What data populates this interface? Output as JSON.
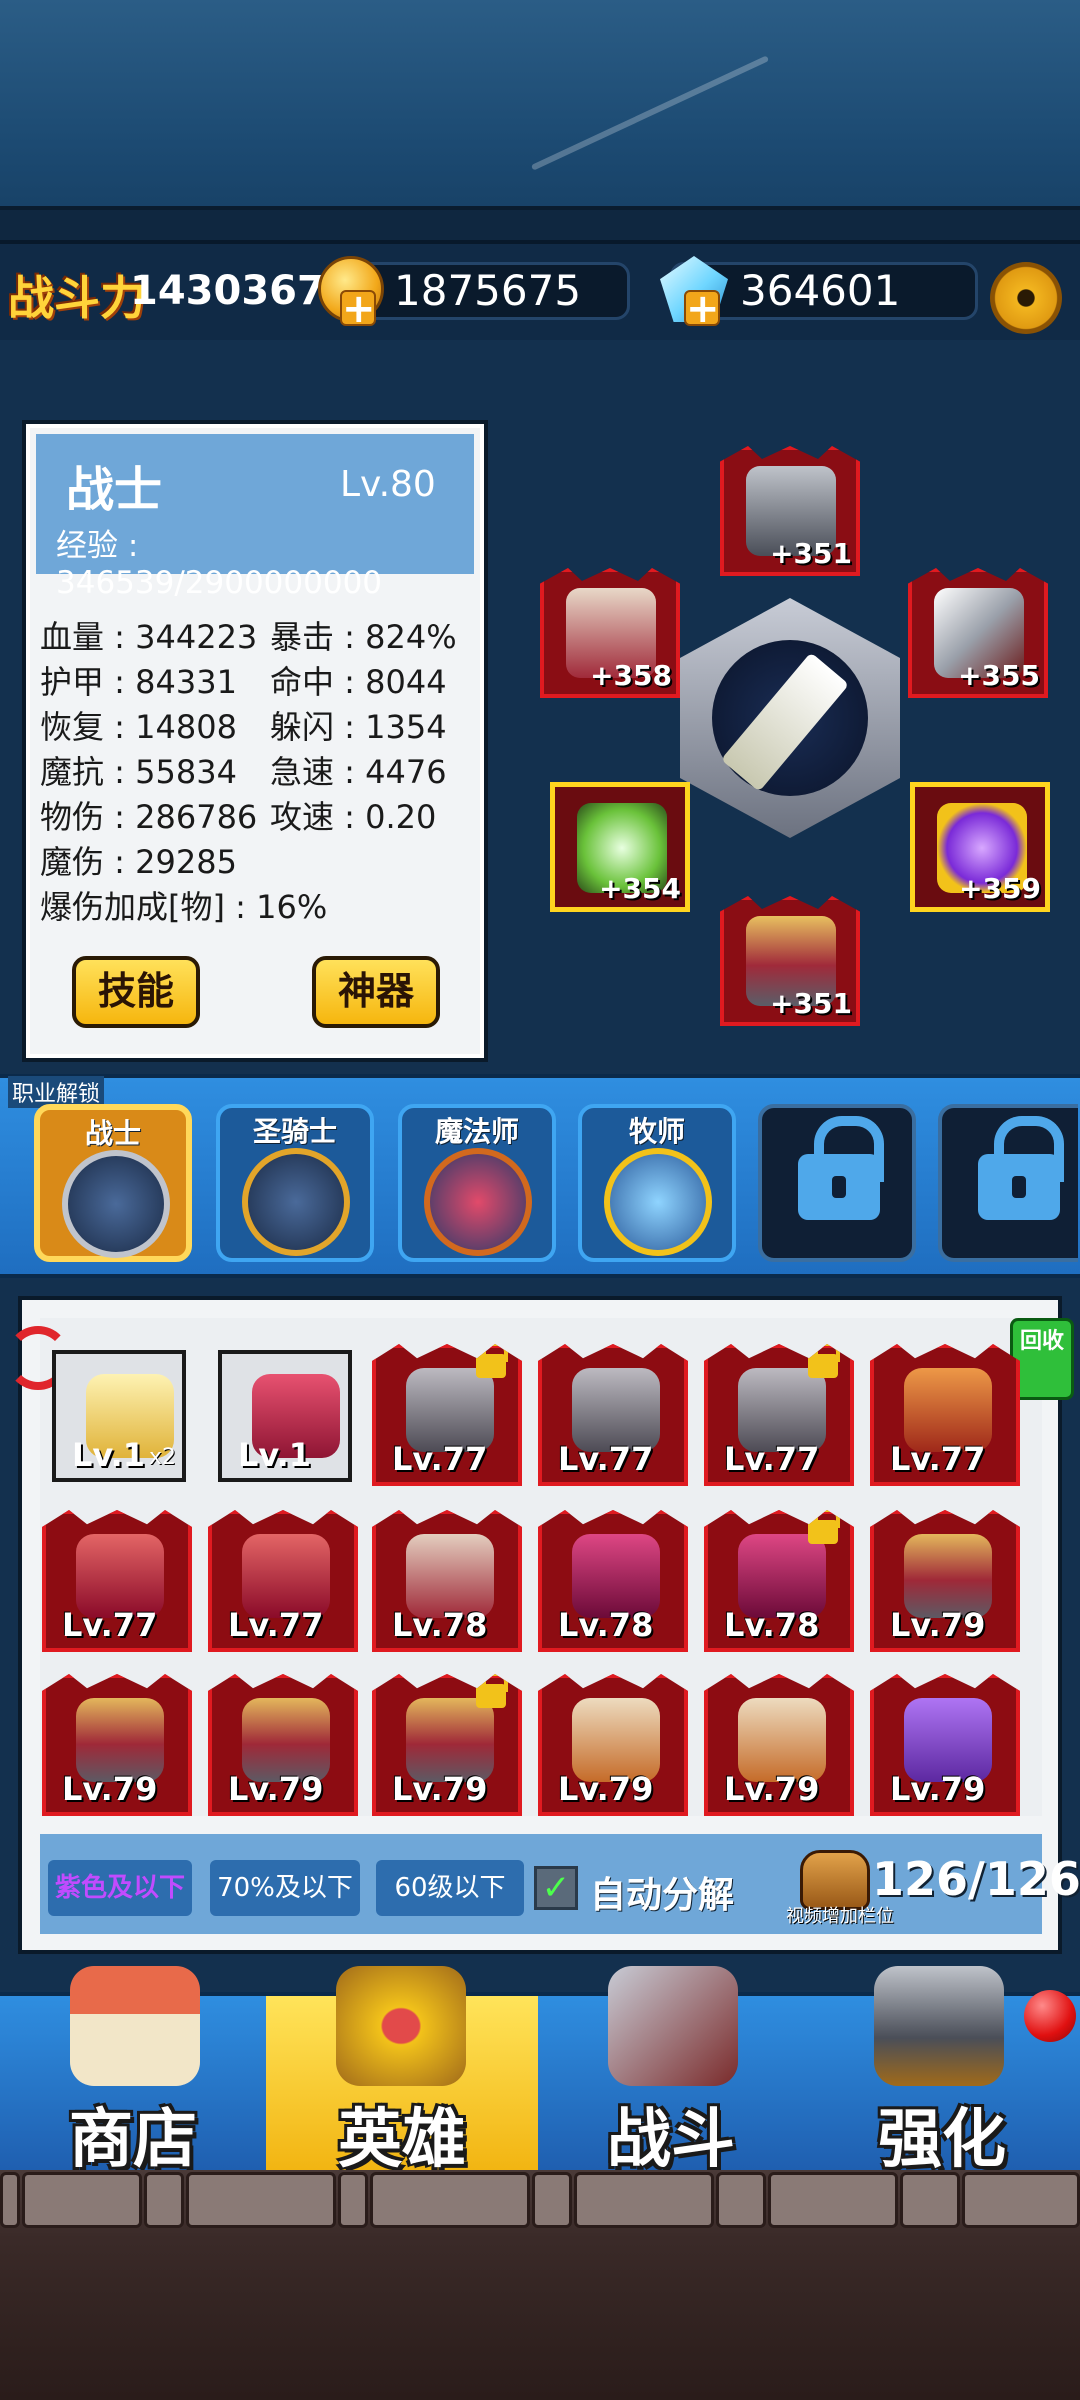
{
  "top_bar": {
    "power_label": "战斗力",
    "power_value": "14303670",
    "gold_value": "1875675",
    "gem_value": "364601"
  },
  "hero": {
    "class_name": "战士",
    "level": "Lv.80",
    "exp": "经验 : 346539/2900000000",
    "stats": [
      "血量 : 344223",
      "暴击 : 824%",
      "护甲 : 84331",
      "命中 : 8044",
      "恢复 : 14808",
      "躲闪 : 1354",
      "魔抗 : 55834",
      "急速 : 4476",
      "物伤 : 286786",
      "攻速 : 0.20",
      "魔伤 : 29285",
      "爆伤加成[物] : 16%"
    ],
    "skill_button": "技能",
    "artifact_button": "神器"
  },
  "equipment": {
    "helmet": "+351",
    "shoulder": "+358",
    "weapon": "+355",
    "offhand": "+354",
    "ring": "+359",
    "boots": "+351"
  },
  "classes": {
    "unlock_label": "职业解锁",
    "tabs": [
      {
        "label": "战士"
      },
      {
        "label": "圣骑士"
      },
      {
        "label": "魔法师"
      },
      {
        "label": "牧师"
      }
    ]
  },
  "inventory": {
    "recycle_label": "回收",
    "items": [
      {
        "lvl": "Lv.1",
        "extra": "x2"
      },
      {
        "lvl": "Lv.1",
        "extra": ""
      },
      {
        "lvl": "Lv.77",
        "extra": ""
      },
      {
        "lvl": "Lv.77",
        "extra": ""
      },
      {
        "lvl": "Lv.77",
        "extra": ""
      },
      {
        "lvl": "Lv.77",
        "extra": ""
      },
      {
        "lvl": "Lv.77",
        "extra": ""
      },
      {
        "lvl": "Lv.77",
        "extra": ""
      },
      {
        "lvl": "Lv.78",
        "extra": ""
      },
      {
        "lvl": "Lv.78",
        "extra": ""
      },
      {
        "lvl": "Lv.78",
        "extra": ""
      },
      {
        "lvl": "Lv.79",
        "extra": ""
      },
      {
        "lvl": "Lv.79",
        "extra": ""
      },
      {
        "lvl": "Lv.79",
        "extra": ""
      },
      {
        "lvl": "Lv.79",
        "extra": ""
      },
      {
        "lvl": "Lv.79",
        "extra": ""
      },
      {
        "lvl": "Lv.79",
        "extra": ""
      },
      {
        "lvl": "Lv.79",
        "extra": ""
      }
    ],
    "filters": [
      "紫色及以下",
      "70%及以下",
      "60级以下"
    ],
    "auto_check": "✓",
    "auto_label": "自动分解",
    "bag_count": "126/126",
    "bag_hint": "视频增加栏位"
  },
  "nav": {
    "shop": "商店",
    "hero": "英雄",
    "battle": "战斗",
    "enhance": "强化"
  },
  "colors": {
    "accent": "#ffd43a",
    "rare_frame": "#e01a20",
    "legend_frame": "#ffd51f",
    "purple_filter": "#c14bff"
  }
}
